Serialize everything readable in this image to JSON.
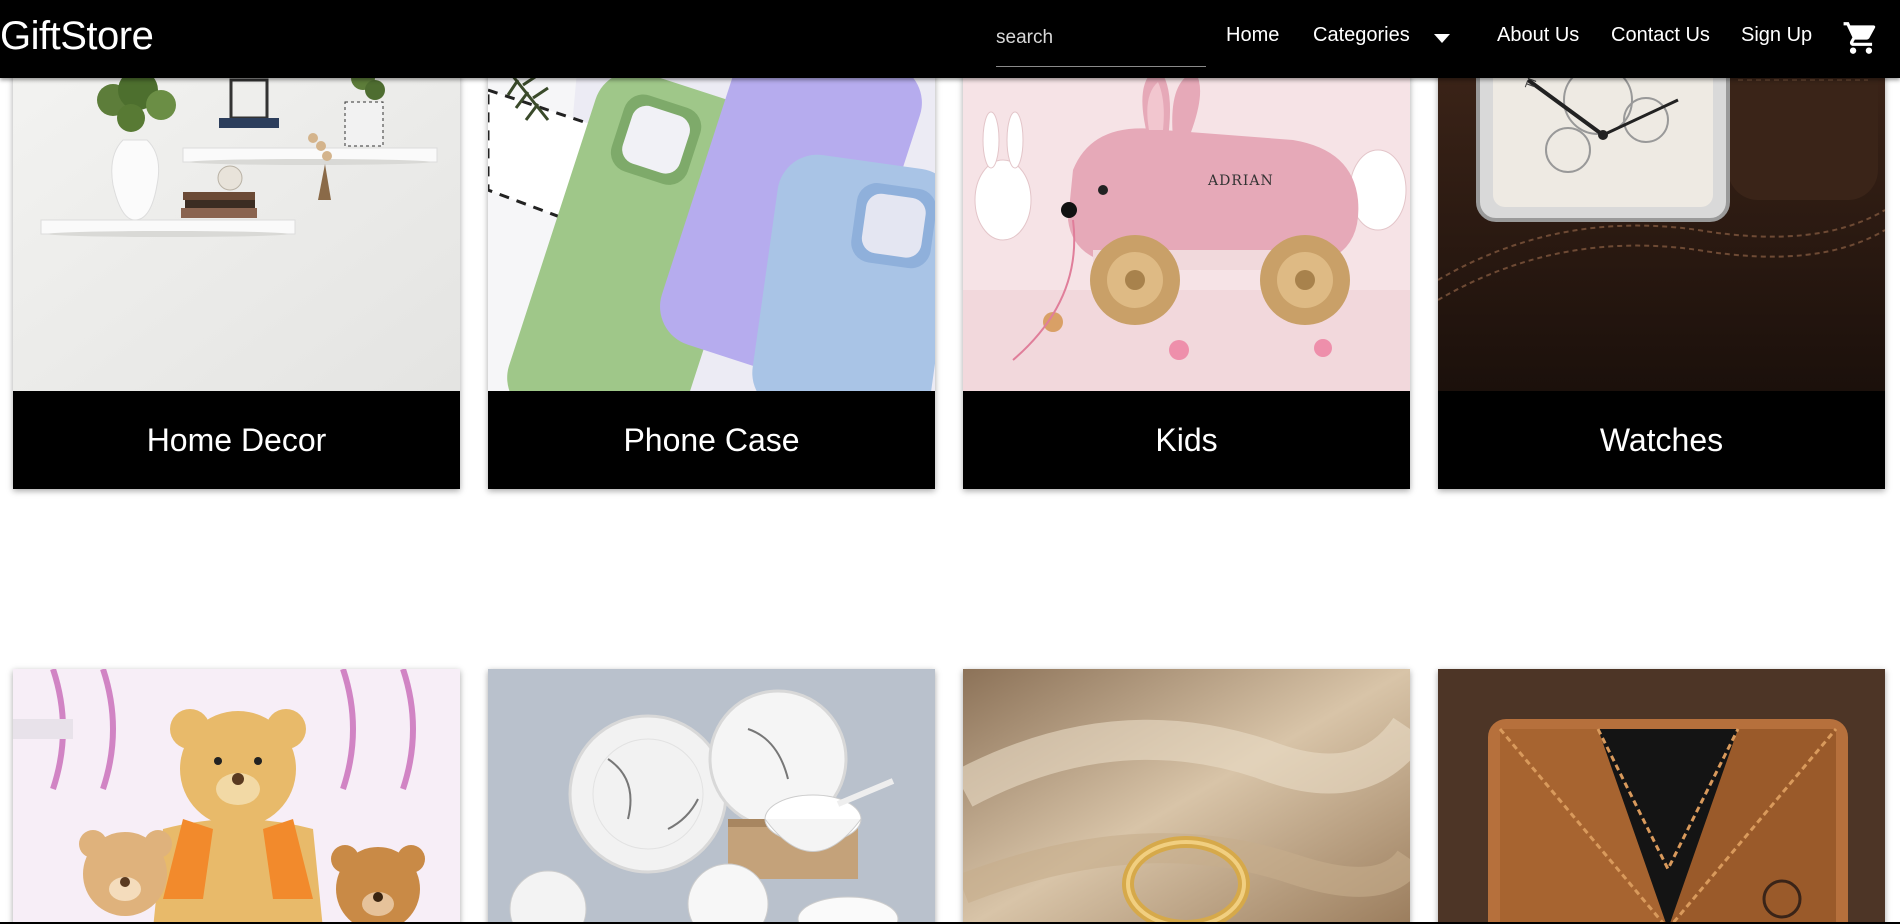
{
  "header": {
    "brand": "GiftStore",
    "search_placeholder": "search",
    "nav": {
      "home": "Home",
      "categories": "Categories",
      "about": "About Us",
      "contact": "Contact Us",
      "signup": "Sign Up"
    },
    "icons": {
      "categories_dropdown": "caret-down-icon",
      "cart": "shopping-cart-icon"
    }
  },
  "categories_row1": [
    {
      "label": "Home Decor"
    },
    {
      "label": "Phone Case"
    },
    {
      "label": "Kids"
    },
    {
      "label": "Watches"
    }
  ],
  "colors": {
    "navbar": "#000000",
    "card_label_bg": "#000000",
    "text": "#ffffff"
  }
}
